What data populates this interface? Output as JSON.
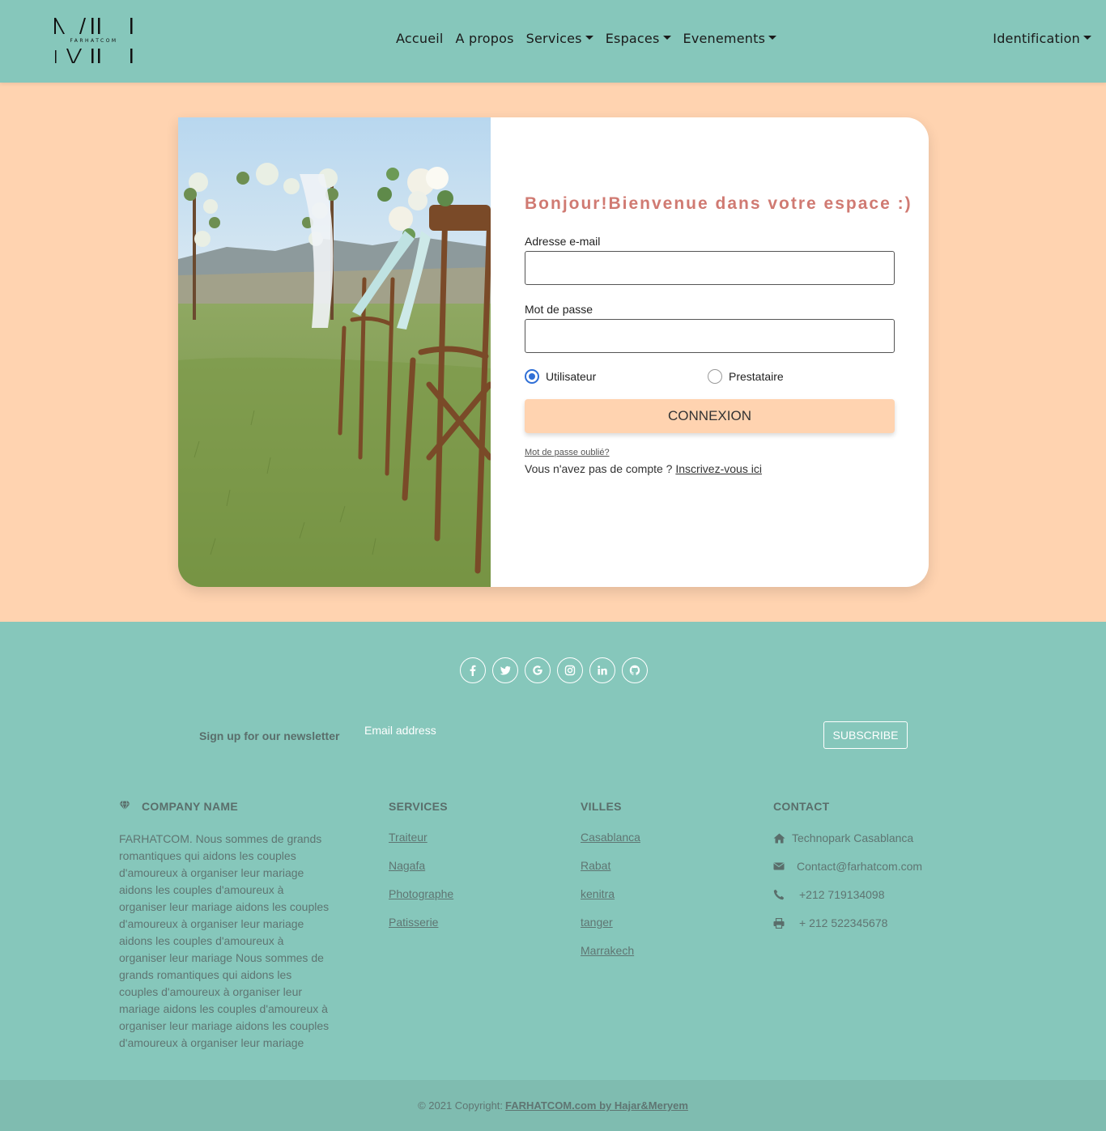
{
  "brand": {
    "logo_text": "FARHATCOM"
  },
  "nav": {
    "links": [
      "Accueil",
      "A propos",
      "Services",
      "Espaces",
      "Evenements"
    ],
    "right": "Identification"
  },
  "login": {
    "greeting": "Bonjour!Bienvenue dans votre espace :)",
    "email_label": "Adresse e-mail",
    "email_value": "",
    "password_label": "Mot de passe",
    "password_value": "",
    "role_options": [
      "Utilisateur",
      "Prestataire"
    ],
    "role_selected": "Utilisateur",
    "submit_label": "CONNEXION",
    "forgot_label": "Mot de passe oublié?",
    "signup_prompt": "Vous n'avez pas de compte ?",
    "signup_link": "Inscrivez-vous ici"
  },
  "footer": {
    "social_icons": [
      "facebook-icon",
      "twitter-icon",
      "google-icon",
      "instagram-icon",
      "linkedin-icon",
      "github-icon"
    ],
    "newsletter_label": "Sign up for our newsletter",
    "email_placeholder": "Email address",
    "subscribe_label": "SUBSCRIBE",
    "company": {
      "title": "COMPANY NAME",
      "about": "FARHATCOM. Nous sommes de grands romantiques qui aidons les couples d'amoureux à organiser leur mariage aidons les couples d'amoureux à organiser leur mariage aidons les couples d'amoureux à organiser leur mariage aidons les couples d'amoureux à organiser leur mariage Nous sommes de grands romantiques qui aidons les couples d'amoureux à organiser leur mariage aidons les couples d'amoureux à organiser leur mariage aidons les couples d'amoureux à organiser leur mariage"
    },
    "services": {
      "title": "SERVICES",
      "items": [
        "Traiteur",
        "Nagafa",
        "Photographe",
        "Patisserie"
      ]
    },
    "villes": {
      "title": "VILLES",
      "items": [
        "Casablanca",
        "Rabat",
        "kenitra",
        "tanger",
        "Marrakech"
      ]
    },
    "contact": {
      "title": "CONTACT",
      "address": "Technopark Casablanca",
      "email": "Contact@farhatcom.com",
      "phone": "+212 719134098",
      "fax": "+ 212 522345678"
    },
    "copyright_prefix": "© 2021 Copyright:",
    "copyright_link": "FARHATCOM.com by Hajar&Meryem"
  },
  "colors": {
    "header_bg": "#86c7bb",
    "page_bg": "#ffd3b0",
    "greeting": "#d07a72",
    "radio_accent": "#2f6fd6",
    "button_bg": "#ffd3b0"
  }
}
